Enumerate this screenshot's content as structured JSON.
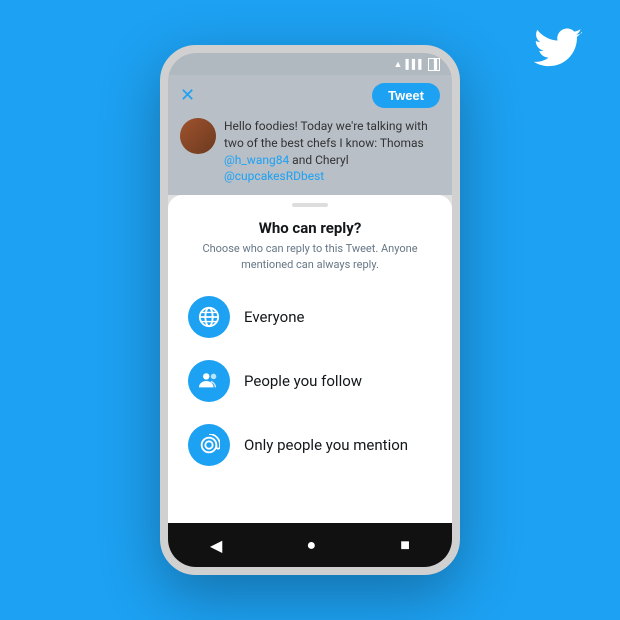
{
  "background": {
    "color": "#1da1f2"
  },
  "twitterLogo": {
    "ariaLabel": "Twitter logo"
  },
  "phone": {
    "statusBar": {
      "wifi": "▲",
      "signal": "▌",
      "battery": "▐"
    },
    "composeArea": {
      "closeLabel": "✕",
      "tweetButtonLabel": "Tweet",
      "tweetText": "Hello foodies! Today we're talking with two of the best chefs I know: Thomas ",
      "mention1": "@h_wang84",
      "tweetTextMid": " and Cheryl ",
      "mention2": "@cupcakesRDbest"
    },
    "bottomSheet": {
      "handleAria": "sheet-handle",
      "title": "Who can reply?",
      "subtitle": "Choose who can reply to this Tweet. Anyone mentioned can always reply.",
      "options": [
        {
          "id": "everyone",
          "label": "Everyone",
          "icon": "🌐",
          "iconAlt": "globe-icon"
        },
        {
          "id": "follow",
          "label": "People you follow",
          "icon": "👥",
          "iconAlt": "people-icon"
        },
        {
          "id": "mention",
          "label": "Only people you mention",
          "icon": "@",
          "iconAlt": "at-icon"
        }
      ]
    },
    "navBar": {
      "back": "◀",
      "home": "●",
      "square": "■"
    }
  }
}
